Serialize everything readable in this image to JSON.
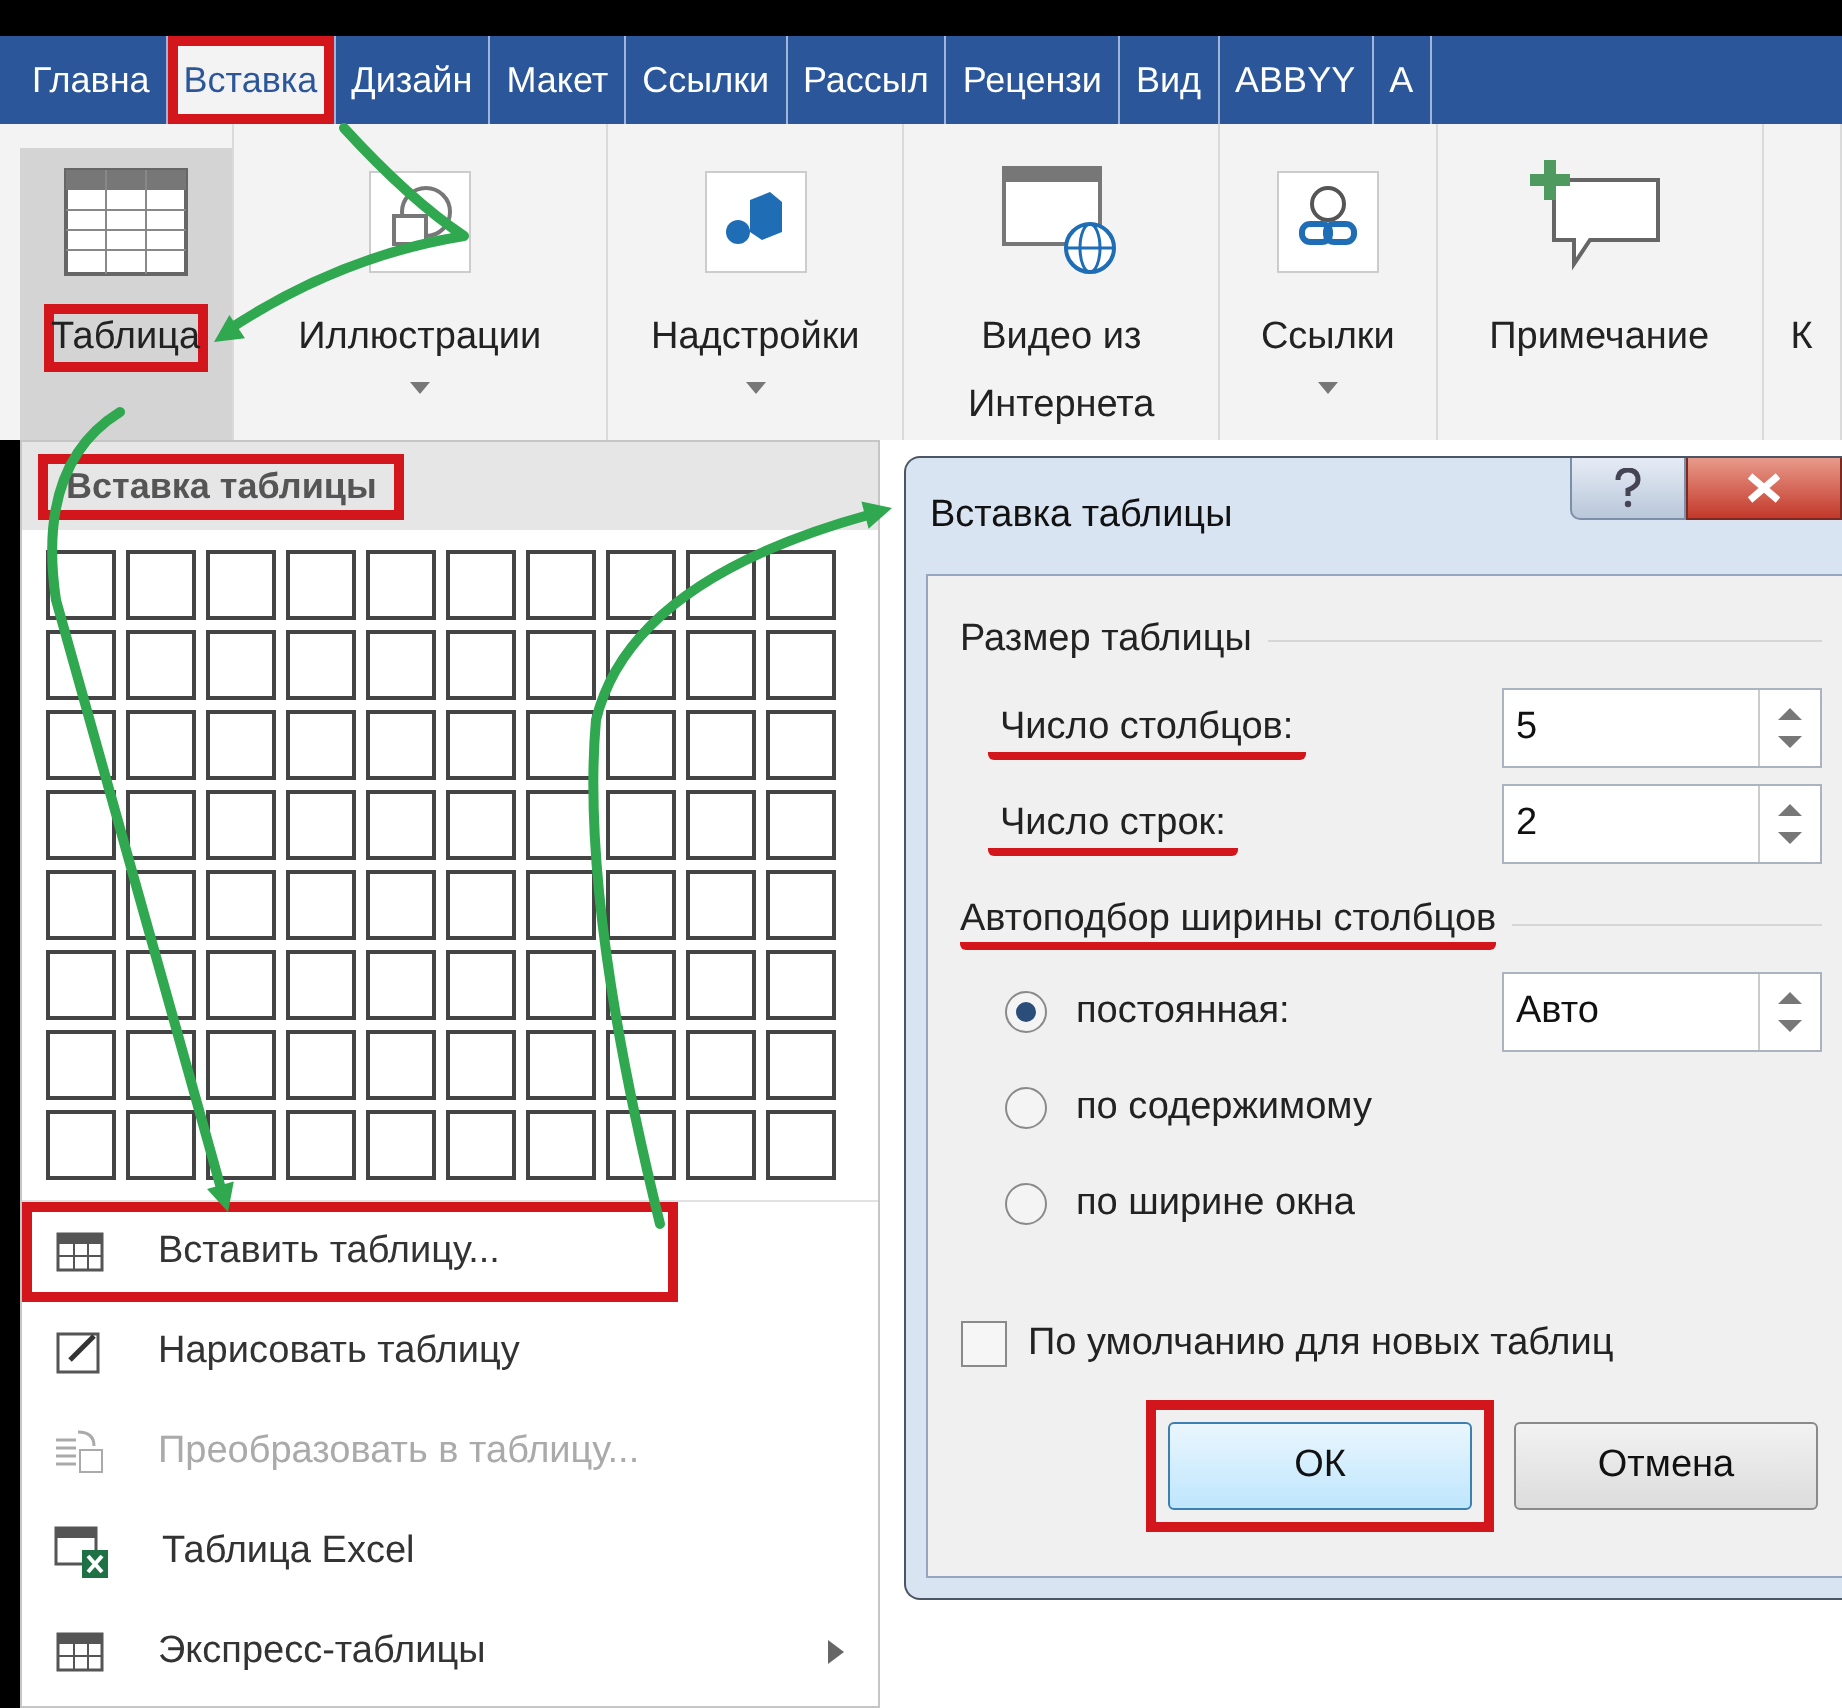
{
  "tabs": [
    {
      "label": "Главна",
      "selected": false,
      "highlighted": false
    },
    {
      "label": "Вставка",
      "selected": true,
      "highlighted": true
    },
    {
      "label": "Дизайн",
      "selected": false,
      "highlighted": false
    },
    {
      "label": "Макет",
      "selected": false,
      "highlighted": false
    },
    {
      "label": "Ссылки",
      "selected": false,
      "highlighted": false
    },
    {
      "label": "Рассыл",
      "selected": false,
      "highlighted": false
    },
    {
      "label": "Рецензи",
      "selected": false,
      "highlighted": false
    },
    {
      "label": "Вид",
      "selected": false,
      "highlighted": false
    },
    {
      "label": "ABBYY",
      "selected": false,
      "highlighted": false
    },
    {
      "label": "А",
      "selected": false,
      "highlighted": false
    }
  ],
  "ribbon": [
    {
      "kind": "table",
      "label": "Таблица",
      "selected": true,
      "dropdown": false,
      "highlighted": true
    },
    {
      "kind": "shapes",
      "label": "Иллюстрации",
      "selected": false,
      "dropdown": true,
      "highlighted": false
    },
    {
      "kind": "addin",
      "label": "Надстройки",
      "selected": false,
      "dropdown": true,
      "highlighted": false
    },
    {
      "kind": "video",
      "label": "Видео из Интернета",
      "selected": false,
      "dropdown": false,
      "highlighted": false
    },
    {
      "kind": "link",
      "label": "Ссылки",
      "selected": false,
      "dropdown": true,
      "highlighted": false
    },
    {
      "kind": "comment",
      "label": "Примечание",
      "selected": false,
      "dropdown": false,
      "highlighted": false
    },
    {
      "kind": "none",
      "label": "К",
      "selected": false,
      "dropdown": false,
      "highlighted": false
    }
  ],
  "table_menu": {
    "title": "Вставка таблицы",
    "highlighted": true,
    "items": [
      {
        "kind": "insert",
        "label": "Вставить таблицу...",
        "disabled": false,
        "submenu": false,
        "highlighted": true
      },
      {
        "kind": "draw",
        "label": "Нарисовать таблицу",
        "disabled": false,
        "submenu": false,
        "highlighted": false
      },
      {
        "kind": "convert",
        "label": "Преобразовать в таблицу...",
        "disabled": true,
        "submenu": false,
        "highlighted": false
      },
      {
        "kind": "excel",
        "label": "Таблица Excel",
        "disabled": false,
        "submenu": false,
        "highlighted": false
      },
      {
        "kind": "quick",
        "label": "Экспресс-таблицы",
        "disabled": false,
        "submenu": true,
        "highlighted": false
      }
    ]
  },
  "dialog": {
    "title": "Вставка таблицы",
    "size_section": "Размер таблицы",
    "fields": [
      {
        "label": "Число столбцов:",
        "value": "5",
        "underlined": true
      },
      {
        "label": "Число строк:",
        "value": "2",
        "underlined": true
      }
    ],
    "autofit_section": "Автоподбор ширины столбцов",
    "autofit_underlined": true,
    "options": [
      {
        "label": "постоянная:",
        "selected": true,
        "value": "Авто"
      },
      {
        "label": "по содержимому",
        "selected": false
      },
      {
        "label": "по ширине окна",
        "selected": false
      }
    ],
    "default_checkbox": {
      "label": "По умолчанию для новых таблиц",
      "checked": false
    },
    "buttons": [
      {
        "label": "ОК",
        "default": true,
        "highlighted": true
      },
      {
        "label": "Отмена",
        "default": false,
        "highlighted": false
      }
    ]
  }
}
